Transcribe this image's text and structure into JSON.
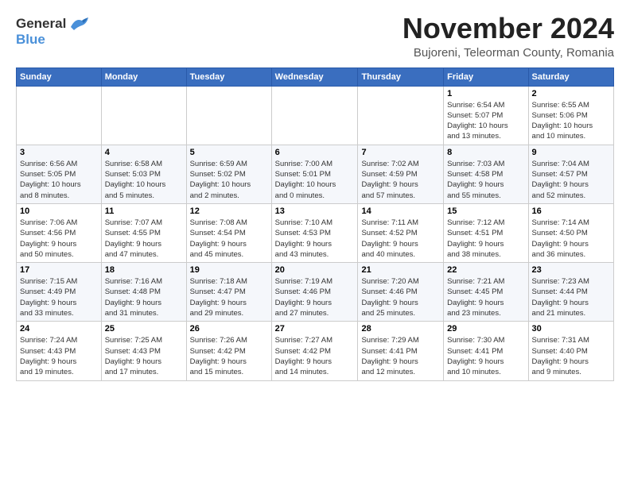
{
  "header": {
    "logo_general": "General",
    "logo_blue": "Blue",
    "month_title": "November 2024",
    "subtitle": "Bujoreni, Teleorman County, Romania"
  },
  "weekdays": [
    "Sunday",
    "Monday",
    "Tuesday",
    "Wednesday",
    "Thursday",
    "Friday",
    "Saturday"
  ],
  "weeks": [
    [
      {
        "day": "",
        "info": ""
      },
      {
        "day": "",
        "info": ""
      },
      {
        "day": "",
        "info": ""
      },
      {
        "day": "",
        "info": ""
      },
      {
        "day": "",
        "info": ""
      },
      {
        "day": "1",
        "info": "Sunrise: 6:54 AM\nSunset: 5:07 PM\nDaylight: 10 hours\nand 13 minutes."
      },
      {
        "day": "2",
        "info": "Sunrise: 6:55 AM\nSunset: 5:06 PM\nDaylight: 10 hours\nand 10 minutes."
      }
    ],
    [
      {
        "day": "3",
        "info": "Sunrise: 6:56 AM\nSunset: 5:05 PM\nDaylight: 10 hours\nand 8 minutes."
      },
      {
        "day": "4",
        "info": "Sunrise: 6:58 AM\nSunset: 5:03 PM\nDaylight: 10 hours\nand 5 minutes."
      },
      {
        "day": "5",
        "info": "Sunrise: 6:59 AM\nSunset: 5:02 PM\nDaylight: 10 hours\nand 2 minutes."
      },
      {
        "day": "6",
        "info": "Sunrise: 7:00 AM\nSunset: 5:01 PM\nDaylight: 10 hours\nand 0 minutes."
      },
      {
        "day": "7",
        "info": "Sunrise: 7:02 AM\nSunset: 4:59 PM\nDaylight: 9 hours\nand 57 minutes."
      },
      {
        "day": "8",
        "info": "Sunrise: 7:03 AM\nSunset: 4:58 PM\nDaylight: 9 hours\nand 55 minutes."
      },
      {
        "day": "9",
        "info": "Sunrise: 7:04 AM\nSunset: 4:57 PM\nDaylight: 9 hours\nand 52 minutes."
      }
    ],
    [
      {
        "day": "10",
        "info": "Sunrise: 7:06 AM\nSunset: 4:56 PM\nDaylight: 9 hours\nand 50 minutes."
      },
      {
        "day": "11",
        "info": "Sunrise: 7:07 AM\nSunset: 4:55 PM\nDaylight: 9 hours\nand 47 minutes."
      },
      {
        "day": "12",
        "info": "Sunrise: 7:08 AM\nSunset: 4:54 PM\nDaylight: 9 hours\nand 45 minutes."
      },
      {
        "day": "13",
        "info": "Sunrise: 7:10 AM\nSunset: 4:53 PM\nDaylight: 9 hours\nand 43 minutes."
      },
      {
        "day": "14",
        "info": "Sunrise: 7:11 AM\nSunset: 4:52 PM\nDaylight: 9 hours\nand 40 minutes."
      },
      {
        "day": "15",
        "info": "Sunrise: 7:12 AM\nSunset: 4:51 PM\nDaylight: 9 hours\nand 38 minutes."
      },
      {
        "day": "16",
        "info": "Sunrise: 7:14 AM\nSunset: 4:50 PM\nDaylight: 9 hours\nand 36 minutes."
      }
    ],
    [
      {
        "day": "17",
        "info": "Sunrise: 7:15 AM\nSunset: 4:49 PM\nDaylight: 9 hours\nand 33 minutes."
      },
      {
        "day": "18",
        "info": "Sunrise: 7:16 AM\nSunset: 4:48 PM\nDaylight: 9 hours\nand 31 minutes."
      },
      {
        "day": "19",
        "info": "Sunrise: 7:18 AM\nSunset: 4:47 PM\nDaylight: 9 hours\nand 29 minutes."
      },
      {
        "day": "20",
        "info": "Sunrise: 7:19 AM\nSunset: 4:46 PM\nDaylight: 9 hours\nand 27 minutes."
      },
      {
        "day": "21",
        "info": "Sunrise: 7:20 AM\nSunset: 4:46 PM\nDaylight: 9 hours\nand 25 minutes."
      },
      {
        "day": "22",
        "info": "Sunrise: 7:21 AM\nSunset: 4:45 PM\nDaylight: 9 hours\nand 23 minutes."
      },
      {
        "day": "23",
        "info": "Sunrise: 7:23 AM\nSunset: 4:44 PM\nDaylight: 9 hours\nand 21 minutes."
      }
    ],
    [
      {
        "day": "24",
        "info": "Sunrise: 7:24 AM\nSunset: 4:43 PM\nDaylight: 9 hours\nand 19 minutes."
      },
      {
        "day": "25",
        "info": "Sunrise: 7:25 AM\nSunset: 4:43 PM\nDaylight: 9 hours\nand 17 minutes."
      },
      {
        "day": "26",
        "info": "Sunrise: 7:26 AM\nSunset: 4:42 PM\nDaylight: 9 hours\nand 15 minutes."
      },
      {
        "day": "27",
        "info": "Sunrise: 7:27 AM\nSunset: 4:42 PM\nDaylight: 9 hours\nand 14 minutes."
      },
      {
        "day": "28",
        "info": "Sunrise: 7:29 AM\nSunset: 4:41 PM\nDaylight: 9 hours\nand 12 minutes."
      },
      {
        "day": "29",
        "info": "Sunrise: 7:30 AM\nSunset: 4:41 PM\nDaylight: 9 hours\nand 10 minutes."
      },
      {
        "day": "30",
        "info": "Sunrise: 7:31 AM\nSunset: 4:40 PM\nDaylight: 9 hours\nand 9 minutes."
      }
    ]
  ]
}
